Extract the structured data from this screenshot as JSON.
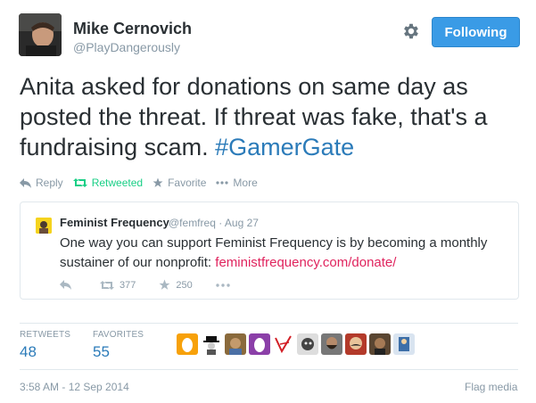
{
  "author": {
    "name": "Mike Cernovich",
    "handle": "@PlayDangerously"
  },
  "follow_button_label": "Following",
  "tweet": {
    "text": "Anita asked for donations on same day as posted the threat. If threat was fake, that's a fundraising scam.",
    "hashtag": "#GamerGate"
  },
  "actions": {
    "reply": "Reply",
    "retweeted": "Retweeted",
    "favorite": "Favorite",
    "more": "More"
  },
  "quoted_tweet": {
    "name": "Feminist Frequency",
    "handle": "@femfreq",
    "separator": " · ",
    "date": "Aug 27",
    "text": "One way you can support Feminist Frequency is by becoming a monthly sustainer of our nonprofit:",
    "link": "feministfrequency.com/donate/",
    "retweets": "377",
    "favorites": "250"
  },
  "stats": {
    "retweets_label": "RETWEETS",
    "retweets": "48",
    "favorites_label": "FAVORITES",
    "favorites": "55"
  },
  "favoriter_avatars": [
    "egg-orange-avatar",
    "spy-figure-avatar",
    "portrait-avatar",
    "egg-purple-avatar",
    "red-v-logo-avatar",
    "bw-face-avatar",
    "bearded-man-avatar",
    "mustache-avatar",
    "brown-face-avatar",
    "blue-figure-avatar"
  ],
  "timestamp": "3:58 AM - 12 Sep 2014",
  "flag_label": "Flag media",
  "colors": {
    "link_blue": "#2b7bb9",
    "follow_button": "#3a9be6",
    "retweet_green": "#19cf86",
    "donate_link": "#e0245e",
    "muted": "#8899a6"
  }
}
